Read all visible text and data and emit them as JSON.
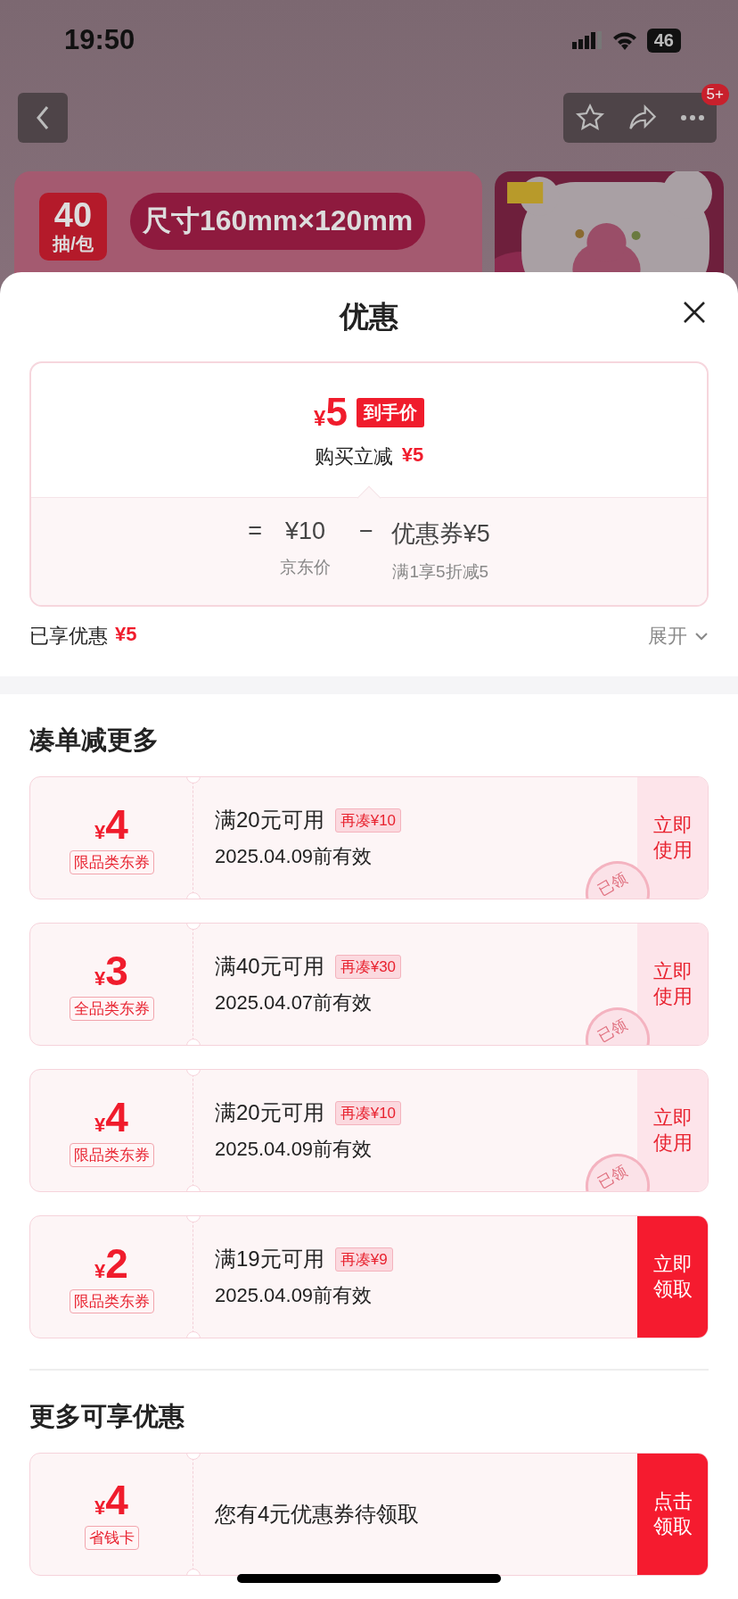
{
  "status_bar": {
    "time": "19:50",
    "battery": "46"
  },
  "nav": {
    "badge": "5+"
  },
  "banner": {
    "count": "40",
    "unit": "抽/包",
    "size": "尺寸160mm×120mm"
  },
  "sheet": {
    "title": "优惠",
    "summary": {
      "currency": "¥",
      "price": "5",
      "price_tag": "到手价",
      "saving_label": "购买立减",
      "saving": "¥5",
      "equals": "=",
      "base_price": "¥10",
      "base_label": "京东价",
      "minus": "−",
      "coupon": "优惠券¥5",
      "coupon_label": "满1享5折减5"
    },
    "enjoyed_label": "已享优惠",
    "enjoyed": "¥5",
    "expand": "展开"
  },
  "sections": [
    {
      "title": "凑单减更多",
      "coupons": [
        {
          "kind": "coupon",
          "currency": "¥",
          "amount": "4",
          "scope": "限品类东券",
          "condition": "满20元可用",
          "tag": "再凑¥10",
          "validity": "2025.04.09前有效",
          "action": "立即使用",
          "claimed": true,
          "stamp": "已领"
        },
        {
          "kind": "coupon",
          "currency": "¥",
          "amount": "3",
          "scope": "全品类东券",
          "condition": "满40元可用",
          "tag": "再凑¥30",
          "validity": "2025.04.07前有效",
          "action": "立即使用",
          "claimed": true,
          "stamp": "已领"
        },
        {
          "kind": "coupon",
          "currency": "¥",
          "amount": "4",
          "scope": "限品类东券",
          "condition": "满20元可用",
          "tag": "再凑¥10",
          "validity": "2025.04.09前有效",
          "action": "立即使用",
          "claimed": true,
          "stamp": "已领"
        },
        {
          "kind": "coupon",
          "currency": "¥",
          "amount": "2",
          "scope": "限品类东券",
          "condition": "满19元可用",
          "tag": "再凑¥9",
          "validity": "2025.04.09前有效",
          "action": "立即领取",
          "claimed": false
        }
      ]
    },
    {
      "title": "更多可享优惠",
      "coupons": [
        {
          "kind": "card",
          "currency": "¥",
          "amount": "4",
          "scope": "省钱卡",
          "message": "您有4元优惠券待领取",
          "action": "点击领取",
          "claimed": false
        }
      ]
    }
  ]
}
